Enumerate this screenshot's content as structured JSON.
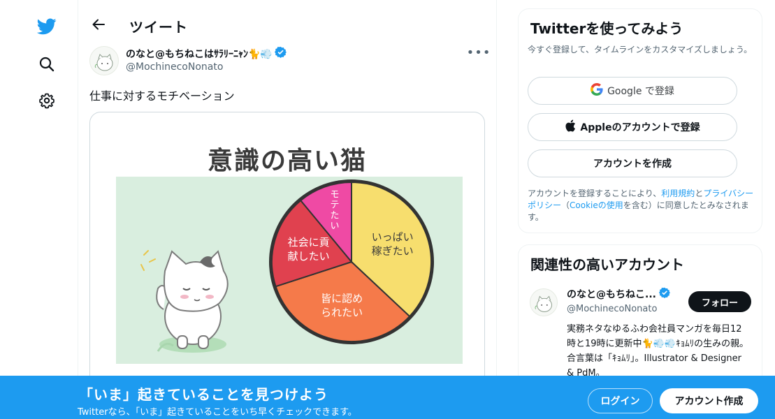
{
  "colors": {
    "brand": "#1d9bf0",
    "text": "#0f1419",
    "muted": "#536471",
    "border": "#cfd9de"
  },
  "nav": {
    "items": [
      {
        "name": "twitter-logo-icon"
      },
      {
        "name": "search-icon"
      },
      {
        "name": "settings-icon"
      }
    ]
  },
  "header": {
    "title": "ツイート"
  },
  "tweet": {
    "author_name": "のなと@もちねこはｻﾗﾘｰﾆｬﾝ🐈💨",
    "author_handle": "@MochinecoNonato",
    "text": "仕事に対するモチベーション",
    "image": {
      "title": "意識の高い猫",
      "pie_labels": [
        "いっぱい稼ぎたい",
        "皆に認められたい",
        "社会に貢献したい",
        "モテたい"
      ],
      "pie_values": [
        37,
        33,
        19,
        11
      ]
    }
  },
  "signup": {
    "title": "Twitterを使ってみよう",
    "subtitle": "今すぐ登録して、タイムラインをカスタマイズしましょう。",
    "google_label": "Google で登録",
    "apple_label": "Appleのアカウントで登録",
    "create_label": "アカウントを作成",
    "legal_1": "アカウントを登録することにより、",
    "legal_terms": "利用規約",
    "legal_2": "と",
    "legal_privacy": "プライバシーポリシー",
    "legal_3": "（",
    "legal_cookie": "Cookieの使用",
    "legal_4": "を含む）に同意したとみなされます。"
  },
  "related": {
    "title": "関連性の高いアカウント",
    "name": "のなと@もちねこ...",
    "handle": "@MochinecoNonato",
    "follow_label": "フォロー",
    "bio": "実務ネタなゆるふわ会社員マンガを毎日12時と19時に更新中🐈💨💨ｷｮﾑﾘの生みの親。合言葉は「ｷｮﾑﾘ」。Illustrator & Designer & PdM。"
  },
  "bottom_bar": {
    "title": "「いま」起きていることを見つけよう",
    "subtitle": "Twitterなら、「いま」起きていることをいち早くチェックできます。",
    "login_label": "ログイン",
    "signup_label": "アカウント作成"
  }
}
